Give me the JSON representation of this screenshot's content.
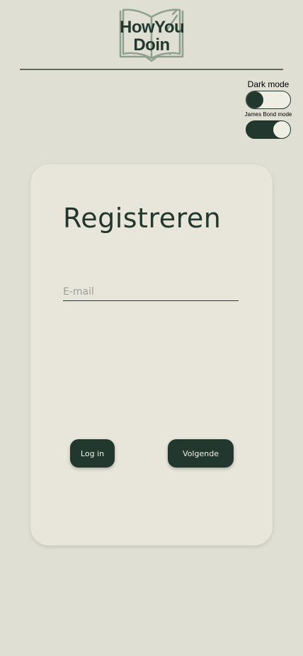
{
  "logo": {
    "line1_left": "How",
    "line1_right": "You",
    "line2": "Doin",
    "icon": "open-book-icon"
  },
  "toggles": {
    "dark_mode_label": "Dark mode",
    "dark_mode_on": false,
    "bond_mode_label": "James Bond mode",
    "bond_mode_on": true
  },
  "card": {
    "title": "Registreren",
    "email_placeholder": "E-mail",
    "email_value": "",
    "login_label": "Log in",
    "next_label": "Volgende"
  },
  "colors": {
    "background": "#dfdfd3",
    "card": "#e8e6da",
    "primary": "#22382f",
    "logo_line": "#8fa08f"
  }
}
